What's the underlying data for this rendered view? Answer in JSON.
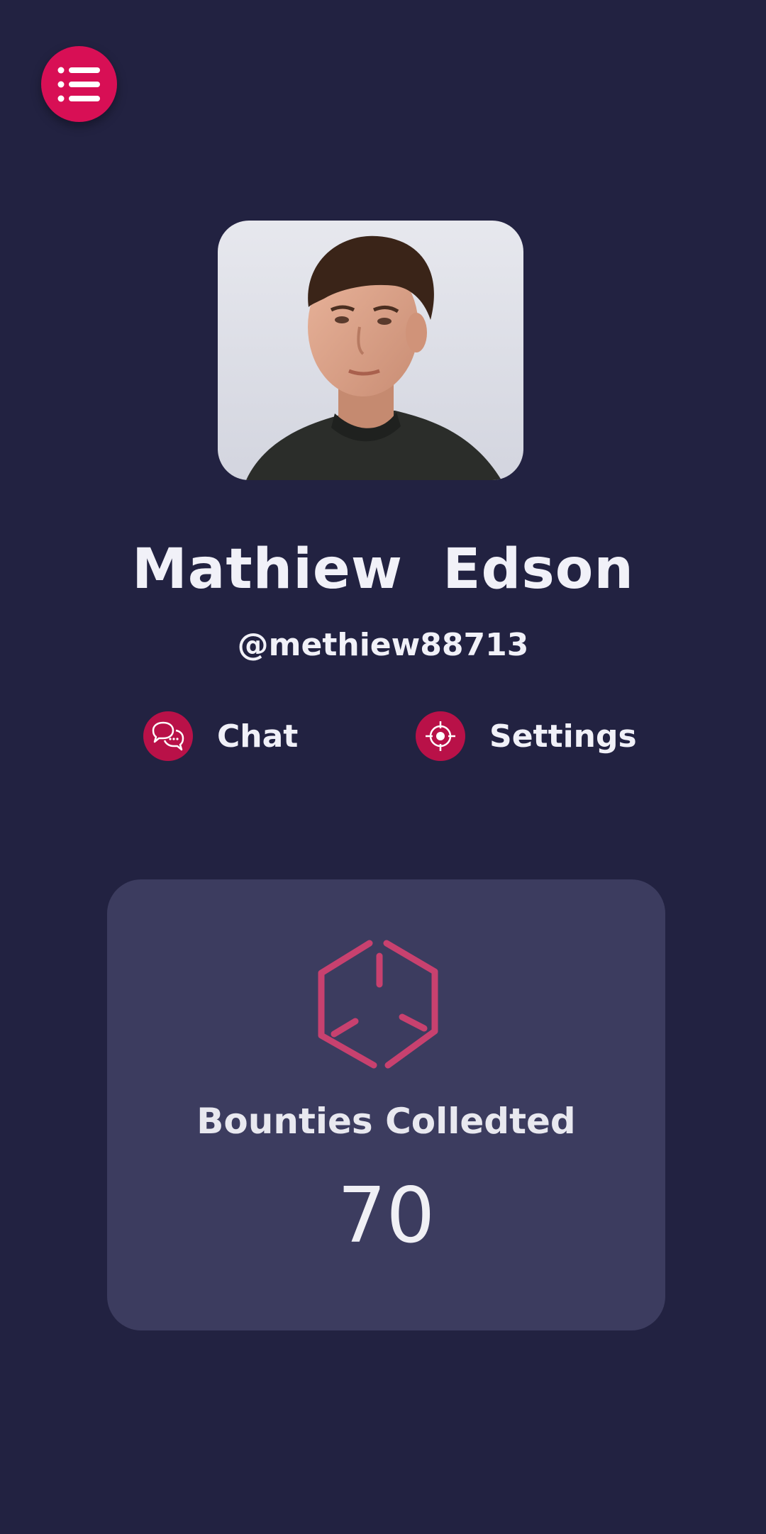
{
  "header": {
    "menu_icon": "list-menu-icon",
    "accent_color": "#d80f55"
  },
  "profile": {
    "avatar_icon": "profile-photo",
    "name": "Mathiew  Edson",
    "handle": "@methiew88713"
  },
  "actions": [
    {
      "label": "Chat",
      "icon": "chat-bubbles-icon"
    },
    {
      "label": "Settings",
      "icon": "target-icon"
    }
  ],
  "stats": {
    "icon": "box-icon",
    "label": "Bounties Colledted",
    "value": "70"
  },
  "colors": {
    "background": "#222241",
    "card": "#3c3c5f",
    "icon_accent": "#c8416f"
  }
}
